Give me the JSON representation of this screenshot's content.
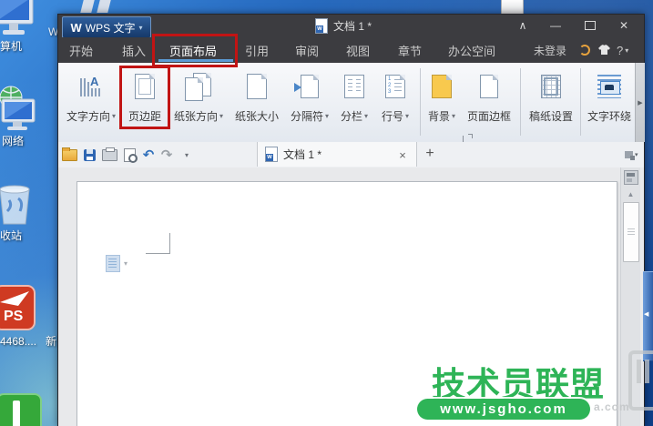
{
  "desktop": {
    "icons": [
      {
        "label": "算机"
      },
      {
        "label": "网络"
      },
      {
        "label": "收站"
      },
      {
        "label": "4468...."
      },
      {
        "label": "新"
      }
    ],
    "stray_text": "W"
  },
  "icons": {
    "dropdown": "▾",
    "fold": "∧",
    "minimize": "—",
    "close": "✕",
    "undo": "↶",
    "redo": "↷",
    "scroll_up": "▲",
    "panel_arrow": "◀",
    "ribbon_more": "▶",
    "help": "?",
    "app_logo": "W",
    "doc_letter": "w",
    "tab_close": "×",
    "new_tab": "+"
  },
  "titlebar": {
    "app_button": "WPS 文字",
    "doc_title": "文档 1 *"
  },
  "tab_bar": {
    "tabs": [
      "开始",
      "插入",
      "页面布局",
      "引用",
      "审阅",
      "视图",
      "章节",
      "办公空间"
    ],
    "active_tab": "页面布局",
    "login_status": "未登录"
  },
  "ribbon": {
    "buttons": [
      {
        "label": "文字方向",
        "dropdown": true
      },
      {
        "label": "页边距",
        "dropdown": false
      },
      {
        "label": "纸张方向",
        "dropdown": true
      },
      {
        "label": "纸张大小",
        "dropdown": false
      },
      {
        "label": "分隔符",
        "dropdown": true
      },
      {
        "label": "分栏",
        "dropdown": true
      },
      {
        "label": "行号",
        "dropdown": true
      },
      {
        "label": "背景",
        "dropdown": true
      },
      {
        "label": "页面边框",
        "dropdown": false
      },
      {
        "label": "稿纸设置",
        "dropdown": false
      },
      {
        "label": "文字环绕",
        "dropdown": false
      }
    ]
  },
  "quick_toolbar": {
    "doc_tab_title": "文档 1 *"
  },
  "watermark": {
    "title": "技术员联盟",
    "url": "www.jsgho.com",
    "faint_text": "a.com"
  },
  "colors": {
    "annotation_red": "#c11414",
    "watermark_green": "#2eb457",
    "accent_blue": "#5b9bd5",
    "titlebar_bg": "#3c3c40"
  }
}
